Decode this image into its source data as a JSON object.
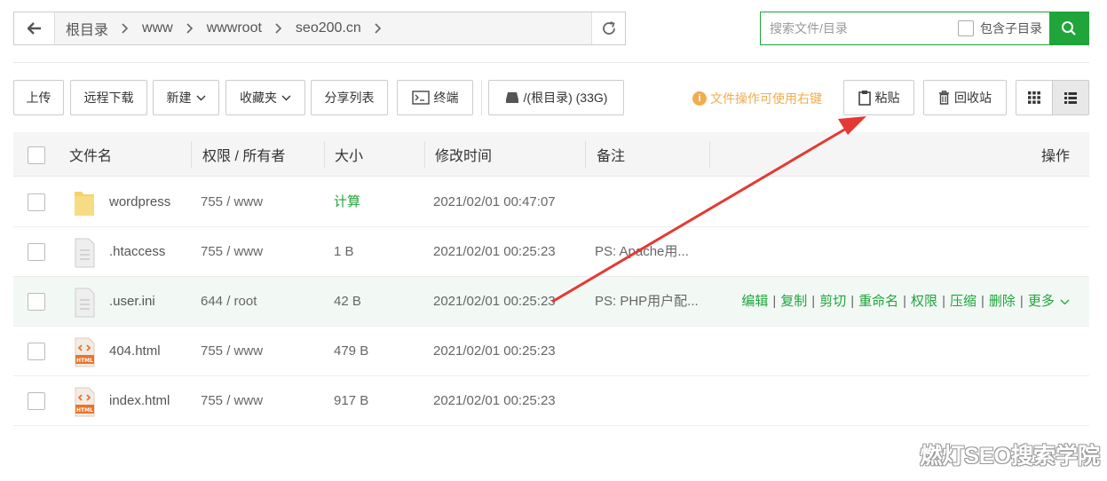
{
  "breadcrumb": [
    "根目录",
    "www",
    "wwwroot",
    "seo200.cn"
  ],
  "search": {
    "placeholder": "搜索文件/目录",
    "include_sub_label": "包含子目录"
  },
  "toolbar": {
    "upload": "上传",
    "remote_download": "远程下载",
    "new": "新建",
    "favorites": "收藏夹",
    "share_list": "分享列表",
    "terminal": "终端",
    "disk": "/(根目录) (33G)",
    "tip": "文件操作可使用右键",
    "paste": "粘贴",
    "recycle": "回收站"
  },
  "columns": {
    "name": "文件名",
    "perm": "权限 / 所有者",
    "size": "大小",
    "mtime": "修改时间",
    "note": "备注",
    "actions": "操作"
  },
  "rows": [
    {
      "name": "wordpress",
      "type": "folder",
      "perm": "755 / www",
      "size": "计算",
      "mtime": "2021/02/01 00:47:07",
      "note": ""
    },
    {
      "name": ".htaccess",
      "type": "file",
      "perm": "755 / www",
      "size": "1 B",
      "mtime": "2021/02/01 00:25:23",
      "note": "PS: Apache用..."
    },
    {
      "name": ".user.ini",
      "type": "file",
      "perm": "644 / root",
      "size": "42 B",
      "mtime": "2021/02/01 00:25:23",
      "note": "PS: PHP用户配..."
    },
    {
      "name": "404.html",
      "type": "html",
      "perm": "755 / www",
      "size": "479 B",
      "mtime": "2021/02/01 00:25:23",
      "note": ""
    },
    {
      "name": "index.html",
      "type": "html",
      "perm": "755 / www",
      "size": "917 B",
      "mtime": "2021/02/01 00:25:23",
      "note": ""
    }
  ],
  "row_actions": [
    "编辑",
    "复制",
    "剪切",
    "重命名",
    "权限",
    "压缩",
    "删除",
    "更多"
  ],
  "html_badge": "HTML",
  "watermark": "燃灯SEO搜索学院",
  "colors": {
    "accent": "#20a53a",
    "tip": "#f0ad4e",
    "arrow": "#e53935"
  }
}
